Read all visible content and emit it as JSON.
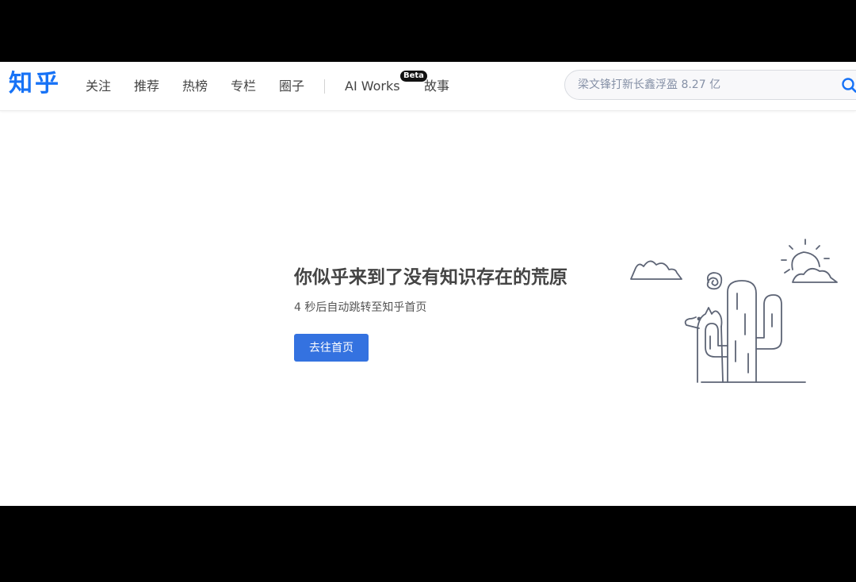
{
  "header": {
    "logo": "知乎",
    "nav": [
      "关注",
      "推荐",
      "热榜",
      "专栏",
      "圈子",
      "AI Works",
      "故事"
    ],
    "beta_badge": "Beta",
    "search": {
      "placeholder": "梁文锋打新长鑫浮盈 8.27 亿"
    }
  },
  "main": {
    "title": "你似乎来到了没有知识存在的荒原",
    "countdown": "4 秒后自动跳转至知乎首页",
    "home_button": "去往首页"
  },
  "colors": {
    "brand": "#1772f6",
    "button": "#3472e0",
    "illustration_stroke": "#5d6475"
  },
  "illustration": {
    "icons": [
      "cloud-icon",
      "sun-icon",
      "scribble-icon",
      "dog-icon",
      "cactus-icon"
    ]
  }
}
